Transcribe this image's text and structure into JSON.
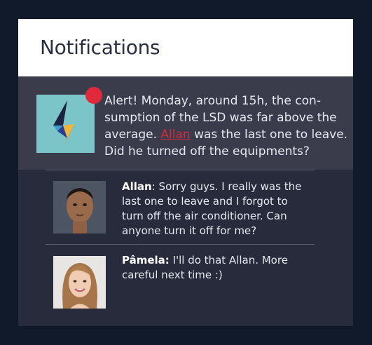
{
  "header": {
    "title": "Notifications"
  },
  "alert": {
    "icon": "lightning-bolt-icon",
    "badge_color": "#e02a3c",
    "text_before": "Alert! Monday, around 15h, the con-sumption of the LSD was far above the average.",
    "link": "Allan",
    "text_after": "was the last one to leave. Did he turned off the equipments?"
  },
  "comments": [
    {
      "author": "Allan",
      "separator": ":",
      "text": "Sorry guys. I really was the last one to leave and I forgot to turn off the air conditioner. Can anyone turn it off for me?"
    },
    {
      "author": "Pâmela:",
      "separator": "",
      "text": "I'll do that Allan. More careful next time :)"
    }
  ]
}
